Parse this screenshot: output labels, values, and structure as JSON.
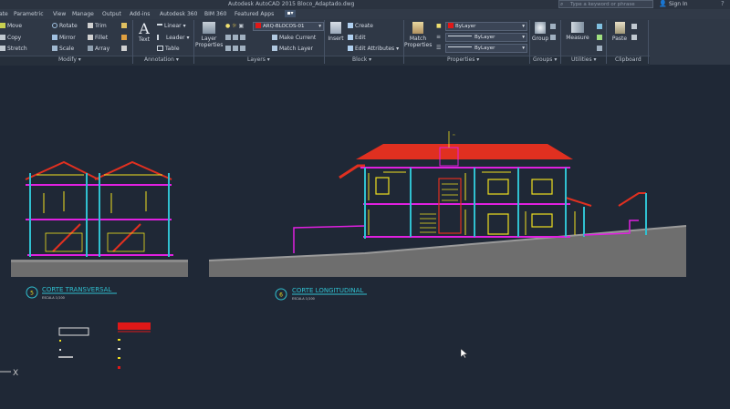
{
  "window": {
    "title": "Autodesk AutoCAD 2015   Bloco_Adaptado.dwg",
    "search_placeholder": "Type a keyword or phrase",
    "sign_in": "Sign In"
  },
  "tabs": [
    "ate",
    "Parametric",
    "View",
    "Manage",
    "Output",
    "Add-ins",
    "Autodesk 360",
    "BIM 360",
    "Featured Apps"
  ],
  "modify": {
    "move": "Move",
    "rotate": "Rotate",
    "trim": "Trim",
    "copy": "Copy",
    "mirror": "Mirror",
    "fillet": "Fillet",
    "stretch": "Stretch",
    "scale": "Scale",
    "array": "Array",
    "panel": "Modify"
  },
  "annotation": {
    "text": "Text",
    "linear": "Linear",
    "leader": "Leader",
    "table": "Table",
    "panel": "Annotation"
  },
  "layers": {
    "layer_properties": "Layer Properties",
    "current_layer": "ARQ-BLOCOS-01",
    "make_current": "Make Current",
    "match_layer": "Match Layer",
    "panel": "Layers"
  },
  "block": {
    "insert": "Insert",
    "create": "Create",
    "edit": "Edit",
    "edit_attributes": "Edit Attributes",
    "panel": "Block"
  },
  "properties": {
    "match_properties": "Match Properties",
    "color": "ByLayer",
    "linetype": "ByLayer",
    "lineweight": "ByLayer",
    "panel": "Properties"
  },
  "groups": {
    "group": "Group",
    "panel": "Groups"
  },
  "utilities": {
    "measure": "Measure",
    "panel": "Utilities"
  },
  "clipboard": {
    "paste": "Paste",
    "panel": "Clipboard"
  },
  "drawing": {
    "section1_title": "CORTE TRANSVERSAL",
    "section1_scale": "ESCALA 1/100",
    "section1_number": "5",
    "section2_title": "CORTE LONGITUDINAL",
    "section2_scale": "ESCALA 1/100",
    "section2_number": "6",
    "axis_x": "X"
  },
  "colors": {
    "background": "#1f2836",
    "ribbon": "#2f3846",
    "layer_color": "#e01818",
    "wall_magenta": "#e020e0",
    "roof_red": "#e03020",
    "dimension_yellow": "#f0e020",
    "ground_gray": "#7a7a7a",
    "cyan": "#30c0d0"
  }
}
